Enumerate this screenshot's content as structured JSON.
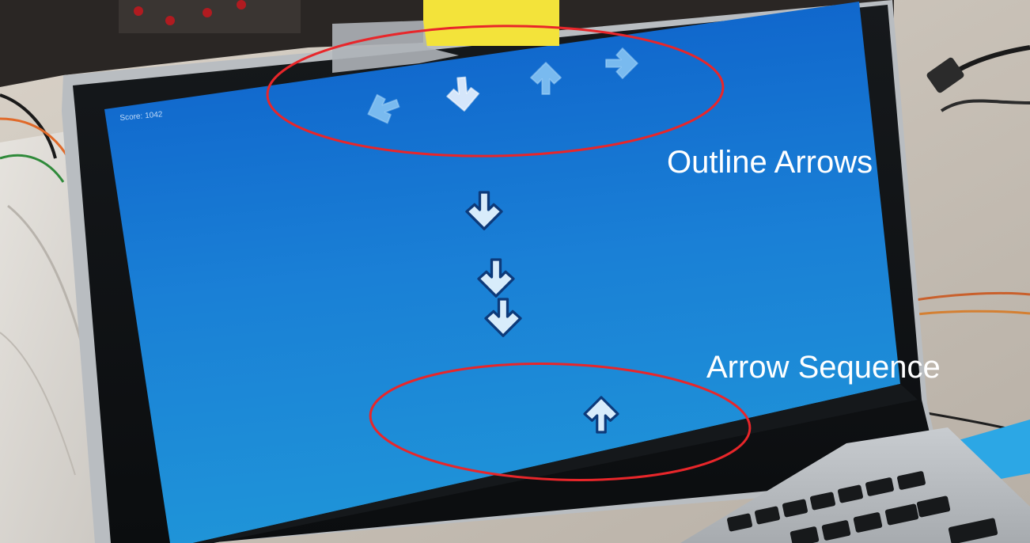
{
  "game": {
    "score_label": "Score:",
    "score_value": "1042",
    "target_arrows": [
      "left",
      "down",
      "up",
      "right"
    ],
    "falling_arrows": [
      "down",
      "down",
      "down",
      "up"
    ]
  },
  "annotations": {
    "outline_arrows": "Outline Arrows",
    "arrow_sequence": "Arrow Sequence"
  },
  "colors": {
    "screen": "#1c86d8",
    "annotation_ring": "#e8262a",
    "annotation_text": "#ffffff"
  }
}
